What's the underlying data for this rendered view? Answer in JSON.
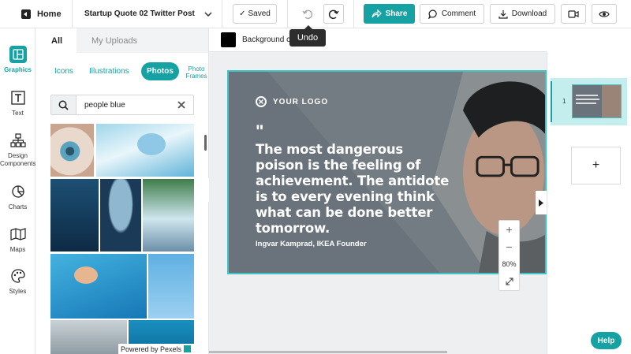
{
  "topbar": {
    "home_label": "Home",
    "doc_title": "Startup Quote 02 Twitter Post",
    "saved_label": "Saved",
    "share_label": "Share",
    "comment_label": "Comment",
    "download_label": "Download",
    "undo_tooltip": "Undo"
  },
  "rail": {
    "items": [
      {
        "label": "Graphics",
        "icon": "graphics-icon"
      },
      {
        "label": "Text",
        "icon": "text-icon"
      },
      {
        "label": "Design Components",
        "icon": "design-components-icon"
      },
      {
        "label": "Charts",
        "icon": "charts-icon"
      },
      {
        "label": "Maps",
        "icon": "maps-icon"
      },
      {
        "label": "Styles",
        "icon": "styles-icon"
      }
    ]
  },
  "panel": {
    "tab_all": "All",
    "tab_uploads": "My Uploads",
    "subcats": [
      "Icons",
      "Illustrations",
      "Photos",
      "Photo Frames"
    ],
    "search_value": "people blue",
    "powered_by": "Powered by Pexels"
  },
  "toolbar": {
    "background_label": "Background c"
  },
  "design": {
    "logo_text": "YOUR LOGO",
    "quote_mark": "\"",
    "quote": "The most dangerous poison is the feeling of achievement. The antidote is to every evening think what can be done better tomorrow.",
    "author": "Ingvar Kamprad, IKEA Founder"
  },
  "zoom": {
    "plus": "+",
    "minus": "−",
    "level": "80%"
  },
  "pages": {
    "current_page": "1",
    "add_label": "+"
  },
  "help_label": "Help",
  "colors": {
    "accent": "#16a2a2",
    "selection": "#42c3c6",
    "card_bg": "#6a737b"
  }
}
